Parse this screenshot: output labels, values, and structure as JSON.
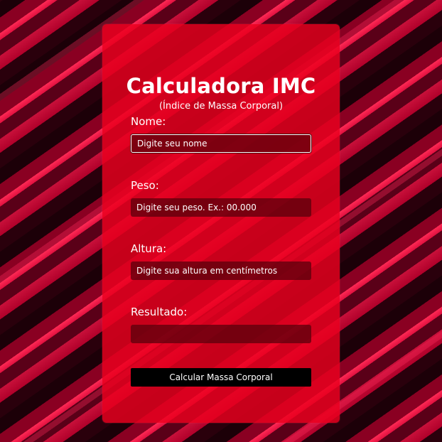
{
  "header": {
    "title": "Calculadora IMC",
    "subtitle": "(Índice de Massa Corporal)"
  },
  "form": {
    "name": {
      "label": "Nome:",
      "placeholder": "Digite seu nome",
      "value": ""
    },
    "weight": {
      "label": "Peso:",
      "placeholder": "Digite seu peso. Ex.: 00.000",
      "value": ""
    },
    "height": {
      "label": "Altura:",
      "placeholder": "Digite sua altura em centímetros",
      "value": ""
    },
    "result": {
      "label": "Resultado:",
      "value": ""
    },
    "submit_label": "Calcular Massa Corporal"
  },
  "colors": {
    "card": "#eb001e",
    "field": "#5a000c",
    "button": "#000000",
    "text": "#ffffff"
  }
}
